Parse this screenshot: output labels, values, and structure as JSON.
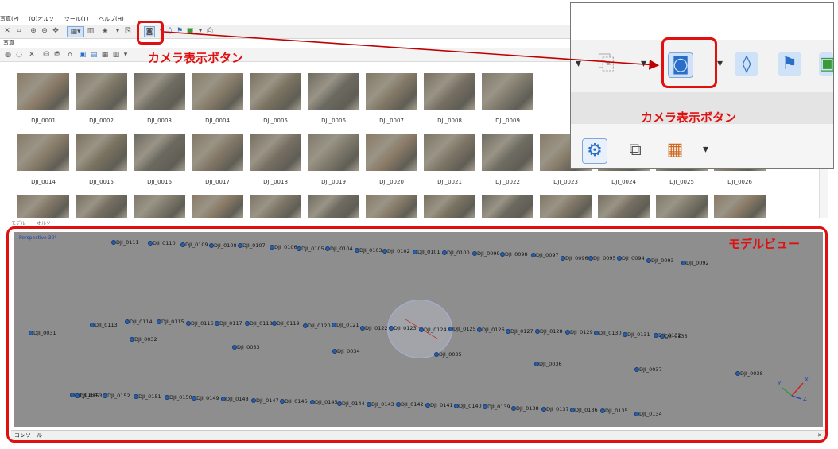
{
  "menu": [
    "写真(P)",
    "(O)オルソ",
    "ツール(T)",
    "ヘルプ(H)"
  ],
  "photo_panel": {
    "tab_label": "写真",
    "rows": [
      [
        "DJI_0001",
        "DJI_0002",
        "DJI_0003",
        "DJI_0004",
        "DJI_0005",
        "DJI_0006",
        "DJI_0007",
        "DJI_0008",
        "DJI_0009"
      ],
      [
        "DJI_0014",
        "DJI_0015",
        "DJI_0016",
        "DJI_0017",
        "DJI_0018",
        "DJI_0019",
        "DJI_0020",
        "DJI_0021",
        "DJI_0022",
        "DJI_0023",
        "DJI_0024",
        "DJI_0025",
        "DJI_0026"
      ]
    ]
  },
  "model_tabs": [
    "モデル",
    "オルソ"
  ],
  "model_view": {
    "perspective": "Perspective 30°",
    "cameras": {
      "c0111": "DJI_0111",
      "c0110": "DJI_0110",
      "c0109": "DJI_0109",
      "c0108": "DJI_0108",
      "c0107": "DJI_0107",
      "c0106": "DJI_0106",
      "c0105": "DJI_0105",
      "c0104": "DJI_0104",
      "c0103": "DJI_0103",
      "c0102": "DJI_0102",
      "c0101": "DJI_0101",
      "c0100": "DJI_0100",
      "c0099": "DJI_0099",
      "c0098": "DJI_0098",
      "c0097": "DJI_0097",
      "c0096": "DJI_0096",
      "c0095": "DJI_0095",
      "c0094": "DJI_0094",
      "c0093": "DJI_0093",
      "c0092": "DJI_0092",
      "c0031": "DJI_0031",
      "c0113": "DJI_0113",
      "c0114": "DJI_0114",
      "c0115": "DJI_0115",
      "c0116": "DJI_0116",
      "c0117": "DJI_0117",
      "c0118": "DJI_0118",
      "c0119": "DJI_0119",
      "c0120": "DJI_0120",
      "c0121": "DJI_0121",
      "c0122": "DJI_0122",
      "c0123": "DJI_0123",
      "c0124": "DJI_0124",
      "c0125": "DJI_0125",
      "c0126": "DJI_0126",
      "c0127": "DJI_0127",
      "c0128": "DJI_0128",
      "c0129": "DJI_0129",
      "c0130": "DJI_0130",
      "c0131": "DJI_0131",
      "c0132": "DJI_0132",
      "c0133": "DJI_0133",
      "c0032": "DJI_0032",
      "c0033": "DJI_0033",
      "c0034": "DJI_0034",
      "c0035": "DJI_0035",
      "c0036": "DJI_0036",
      "c0037": "DJI_0037",
      "c0038": "DJI_0038",
      "c0154": "DJI_0154",
      "c0153": "DJI_0153",
      "c0152": "DJI_0152",
      "c0151": "DJI_0151",
      "c0150": "DJI_0150",
      "c0149": "DJI_0149",
      "c0148": "DJI_0148",
      "c0147": "DJI_0147",
      "c0146": "DJI_0146",
      "c0145": "DJI_0145",
      "c0144": "DJI_0144",
      "c0143": "DJI_0143",
      "c0142": "DJI_0142",
      "c0141": "DJI_0141",
      "c0140": "DJI_0140",
      "c0139": "DJI_0139",
      "c0138": "DJI_0138",
      "c0137": "DJI_0137",
      "c0136": "DJI_0136",
      "c0135": "DJI_0135",
      "c0134": "DJI_0134"
    },
    "axes": {
      "x": "X",
      "y": "Y",
      "z": "Z"
    }
  },
  "console_label": "コンソール",
  "annotations": {
    "camera_button_small": "カメラ表示ボタン",
    "camera_button_zoom": "カメラ表示ボタン",
    "model_view": "モデルビュー"
  },
  "colors": {
    "annotation_red": "#e01010",
    "camera_blue": "#2b5fa8",
    "model_bg": "#8e8e8e"
  },
  "icons": [
    "camera-icon",
    "tag-icon",
    "flag-icon",
    "image-icon",
    "gear-icon",
    "layers-icon",
    "grid-icon"
  ]
}
